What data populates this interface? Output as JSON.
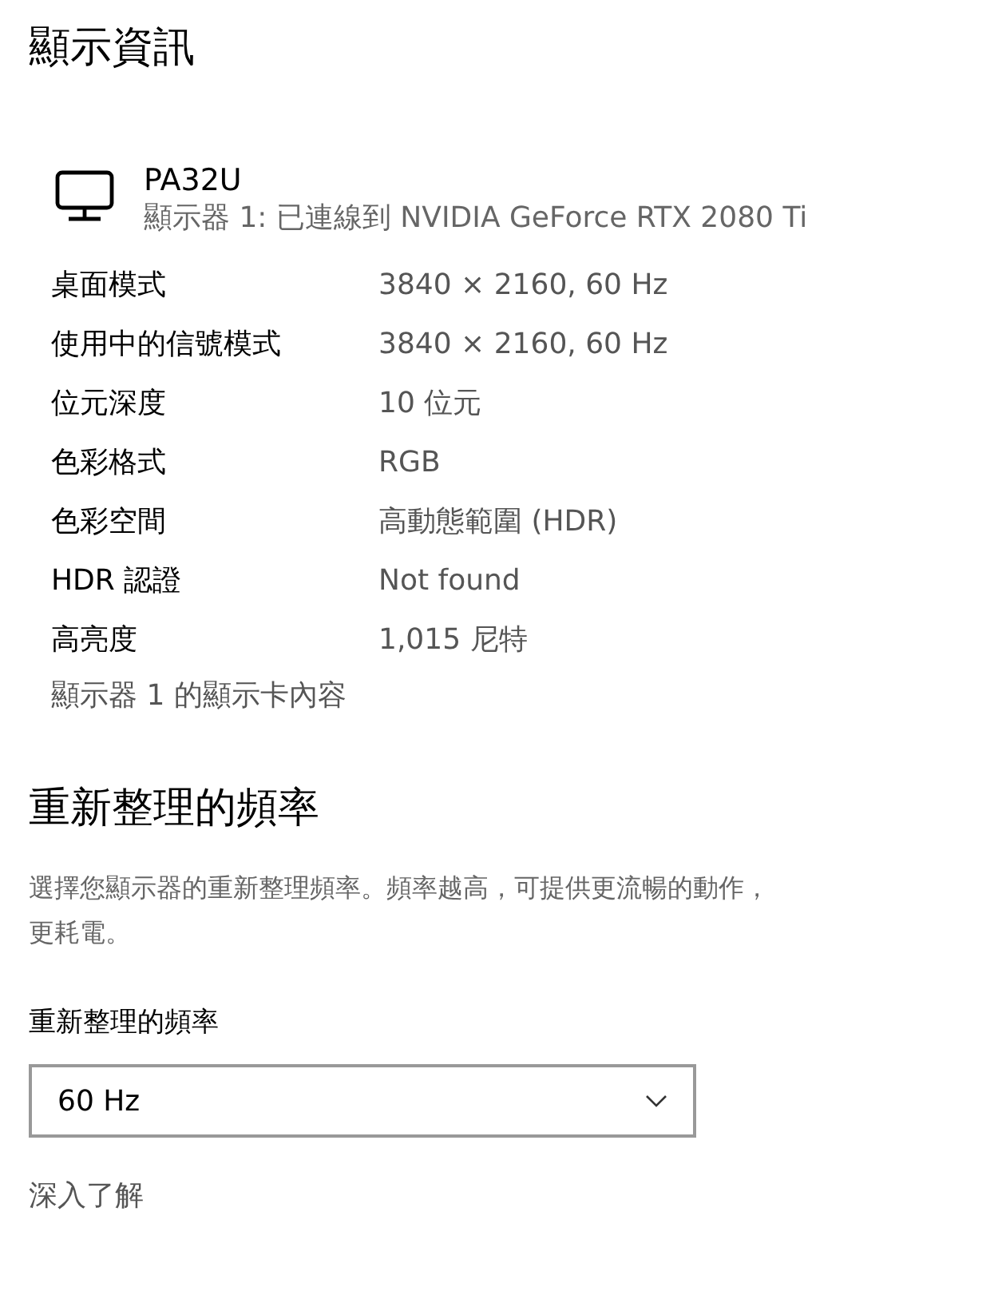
{
  "page_title": "顯示資訊",
  "monitor": {
    "name": "PA32U",
    "connection": "顯示器 1: 已連線到 NVIDIA GeForce RTX 2080 Ti"
  },
  "properties": [
    {
      "label": "桌面模式",
      "value": "3840 × 2160, 60 Hz"
    },
    {
      "label": "使用中的信號模式",
      "value": "3840 × 2160, 60 Hz"
    },
    {
      "label": "位元深度",
      "value": "10 位元"
    },
    {
      "label": "色彩格式",
      "value": "RGB"
    },
    {
      "label": "色彩空間",
      "value": "高動態範圍 (HDR)"
    },
    {
      "label": "HDR 認證",
      "value": "Not found"
    },
    {
      "label": "高亮度",
      "value": "1,015 尼特"
    }
  ],
  "adapter_link": "顯示器 1 的顯示卡內容",
  "refresh_section": {
    "title": "重新整理的頻率",
    "description": "選擇您顯示器的重新整理頻率。頻率越高，可提供更流暢的動作，更耗電。",
    "field_label": "重新整理的頻率",
    "dropdown_value": "60 Hz",
    "learn_more": "深入了解"
  }
}
